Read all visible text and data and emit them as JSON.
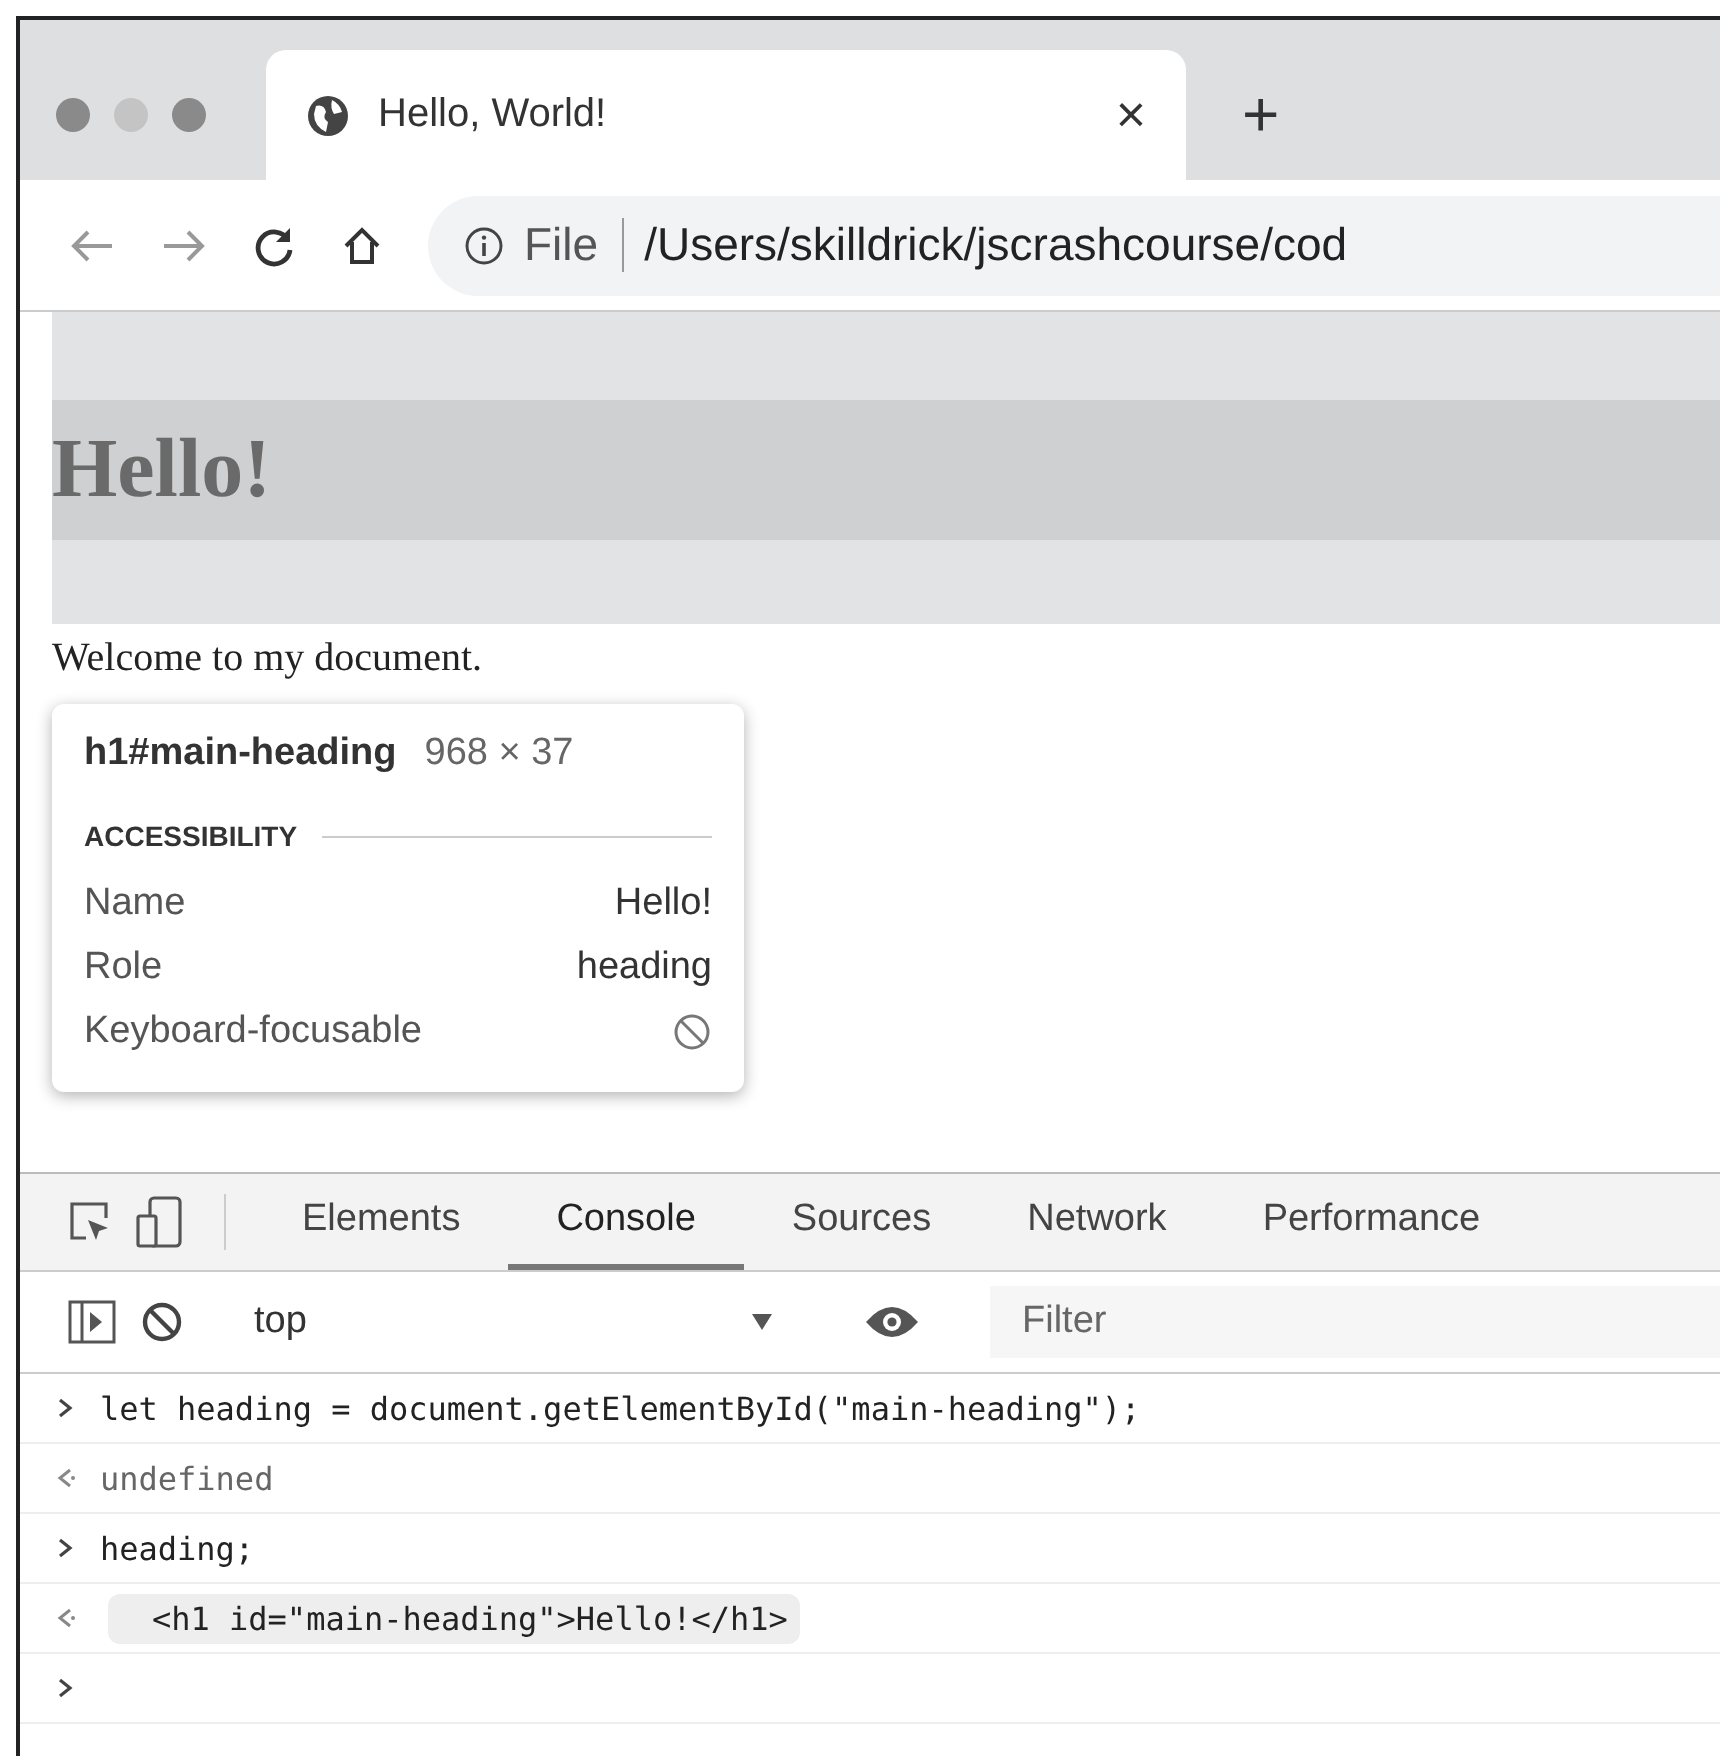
{
  "browser": {
    "tab": {
      "title": "Hello, World!",
      "close": "×",
      "new_tab": "+"
    },
    "address": {
      "scheme": "File",
      "path": "/Users/skilldrick/jscrashcourse/cod"
    }
  },
  "page": {
    "heading": "Hello!",
    "heading_highlighted": true,
    "paragraph": "Welcome to my document."
  },
  "tooltip": {
    "selector": "h1#main-heading",
    "size": "968 × 37",
    "section": "ACCESSIBILITY",
    "rows": [
      {
        "label": "Name",
        "kind": "text",
        "value": "Hello!"
      },
      {
        "label": "Role",
        "kind": "text",
        "value": "heading"
      },
      {
        "label": "Keyboard-focusable",
        "kind": "not-allowed"
      }
    ]
  },
  "devtools": {
    "tabs": [
      {
        "label": "Elements",
        "selected": false
      },
      {
        "label": "Console",
        "selected": true
      },
      {
        "label": "Sources",
        "selected": false
      },
      {
        "label": "Network",
        "selected": false
      },
      {
        "label": "Performance",
        "selected": false
      }
    ],
    "context": "top",
    "filter": {
      "placeholder": "Filter"
    },
    "console": [
      {
        "kind": "input",
        "text": "let heading = document.getElementById(\"main-heading\");"
      },
      {
        "kind": "output",
        "text": "undefined"
      },
      {
        "kind": "input",
        "text": "heading;"
      },
      {
        "kind": "element",
        "text": "<h1 id=\"main-heading\">Hello!</h1>"
      }
    ],
    "prompt_ready": true
  }
}
